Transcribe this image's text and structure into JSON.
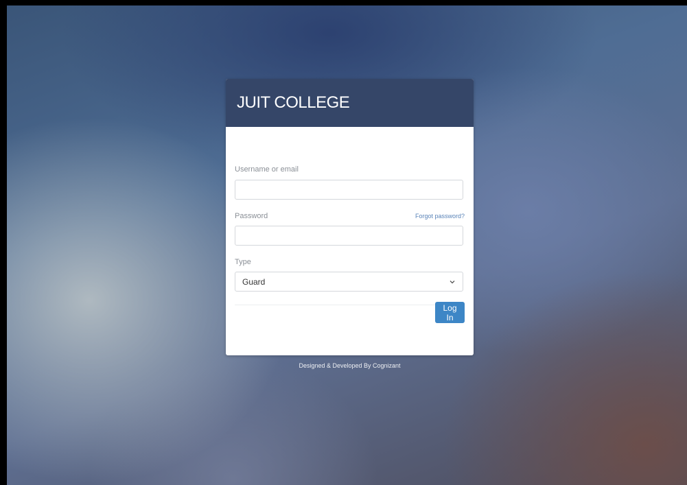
{
  "header": {
    "title": "JUIT COLLEGE"
  },
  "form": {
    "username_label": "Username or email",
    "username_value": "",
    "password_label": "Password",
    "password_value": "",
    "forgot_link": "Forgot password?",
    "type_label": "Type",
    "type_selected": "Guard",
    "login_button": "Log In"
  },
  "footer": {
    "credit": "Designed & Developed By Cognizant"
  },
  "colors": {
    "header_bg": "#354668",
    "button_bg": "#3d86c6",
    "link": "#5a84b8"
  },
  "icons": {
    "select_arrow": "chevron-down-icon"
  }
}
